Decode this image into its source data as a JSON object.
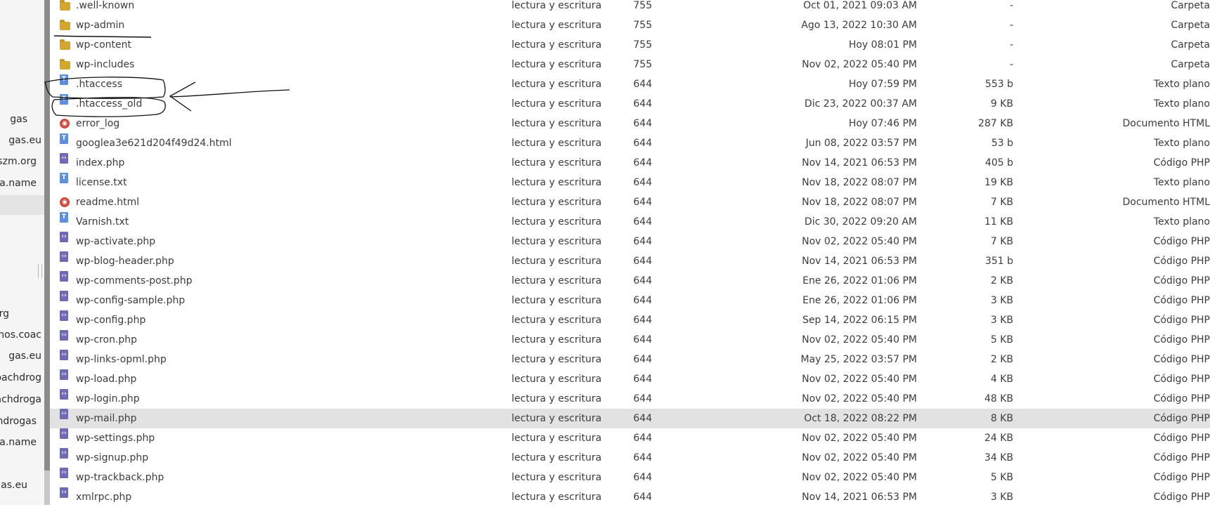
{
  "sidebar": {
    "items": [
      "gas",
      "gas.eu",
      "uszm.org",
      "a.name",
      "rg",
      "mos.coac",
      "gas.eu",
      "oachdrog",
      "achdroga",
      "achdrogas",
      "rita.name",
      "gas.eu"
    ]
  },
  "files": [
    {
      "name": ".well-known",
      "icon": "folder-icon",
      "kind": "folder",
      "perm": "lectura y escritura",
      "octal": "755",
      "date": "Oct 01, 2021 09:03 AM",
      "size": "-",
      "type": "Carpeta"
    },
    {
      "name": "wp-admin",
      "icon": "folder-icon",
      "kind": "folder",
      "perm": "lectura y escritura",
      "octal": "755",
      "date": "Ago 13, 2022 10:30 AM",
      "size": "-",
      "type": "Carpeta"
    },
    {
      "name": "wp-content",
      "icon": "folder-icon",
      "kind": "folder",
      "perm": "lectura y escritura",
      "octal": "755",
      "date": "Hoy 08:01 PM",
      "size": "-",
      "type": "Carpeta"
    },
    {
      "name": "wp-includes",
      "icon": "folder-icon",
      "kind": "folder",
      "perm": "lectura y escritura",
      "octal": "755",
      "date": "Nov 02, 2022 05:40 PM",
      "size": "-",
      "type": "Carpeta"
    },
    {
      "name": ".htaccess",
      "icon": "text-file-icon",
      "kind": "txt",
      "perm": "lectura y escritura",
      "octal": "644",
      "date": "Hoy 07:59 PM",
      "size": "553 b",
      "type": "Texto plano"
    },
    {
      "name": ".htaccess_old",
      "icon": "text-file-icon",
      "kind": "txt",
      "perm": "lectura y escritura",
      "octal": "644",
      "date": "Dic 23, 2022 00:37 AM",
      "size": "9 KB",
      "type": "Texto plano"
    },
    {
      "name": "error_log",
      "icon": "html-file-icon",
      "kind": "html",
      "perm": "lectura y escritura",
      "octal": "644",
      "date": "Hoy 07:46 PM",
      "size": "287 KB",
      "type": "Documento HTML"
    },
    {
      "name": "googlea3e621d204f49d24.html",
      "icon": "text-file-icon",
      "kind": "txt",
      "perm": "lectura y escritura",
      "octal": "644",
      "date": "Jun 08, 2022 03:57 PM",
      "size": "53 b",
      "type": "Texto plano"
    },
    {
      "name": "index.php",
      "icon": "php-file-icon",
      "kind": "php",
      "perm": "lectura y escritura",
      "octal": "644",
      "date": "Nov 14, 2021 06:53 PM",
      "size": "405 b",
      "type": "Código PHP"
    },
    {
      "name": "license.txt",
      "icon": "text-file-icon",
      "kind": "txt",
      "perm": "lectura y escritura",
      "octal": "644",
      "date": "Nov 18, 2022 08:07 PM",
      "size": "19 KB",
      "type": "Texto plano"
    },
    {
      "name": "readme.html",
      "icon": "html-file-icon",
      "kind": "html",
      "perm": "lectura y escritura",
      "octal": "644",
      "date": "Nov 18, 2022 08:07 PM",
      "size": "7 KB",
      "type": "Documento HTML"
    },
    {
      "name": "Varnish.txt",
      "icon": "text-file-icon",
      "kind": "txt",
      "perm": "lectura y escritura",
      "octal": "644",
      "date": "Dic 30, 2022 09:20 AM",
      "size": "11 KB",
      "type": "Texto plano"
    },
    {
      "name": "wp-activate.php",
      "icon": "php-file-icon",
      "kind": "php",
      "perm": "lectura y escritura",
      "octal": "644",
      "date": "Nov 02, 2022 05:40 PM",
      "size": "7 KB",
      "type": "Código PHP"
    },
    {
      "name": "wp-blog-header.php",
      "icon": "php-file-icon",
      "kind": "php",
      "perm": "lectura y escritura",
      "octal": "644",
      "date": "Nov 14, 2021 06:53 PM",
      "size": "351 b",
      "type": "Código PHP"
    },
    {
      "name": "wp-comments-post.php",
      "icon": "php-file-icon",
      "kind": "php",
      "perm": "lectura y escritura",
      "octal": "644",
      "date": "Ene 26, 2022 01:06 PM",
      "size": "2 KB",
      "type": "Código PHP"
    },
    {
      "name": "wp-config-sample.php",
      "icon": "php-file-icon",
      "kind": "php",
      "perm": "lectura y escritura",
      "octal": "644",
      "date": "Ene 26, 2022 01:06 PM",
      "size": "3 KB",
      "type": "Código PHP"
    },
    {
      "name": "wp-config.php",
      "icon": "php-file-icon",
      "kind": "php",
      "perm": "lectura y escritura",
      "octal": "644",
      "date": "Sep 14, 2022 06:15 PM",
      "size": "3 KB",
      "type": "Código PHP"
    },
    {
      "name": "wp-cron.php",
      "icon": "php-file-icon",
      "kind": "php",
      "perm": "lectura y escritura",
      "octal": "644",
      "date": "Nov 02, 2022 05:40 PM",
      "size": "5 KB",
      "type": "Código PHP"
    },
    {
      "name": "wp-links-opml.php",
      "icon": "php-file-icon",
      "kind": "php",
      "perm": "lectura y escritura",
      "octal": "644",
      "date": "May 25, 2022 03:57 PM",
      "size": "2 KB",
      "type": "Código PHP"
    },
    {
      "name": "wp-load.php",
      "icon": "php-file-icon",
      "kind": "php",
      "perm": "lectura y escritura",
      "octal": "644",
      "date": "Nov 02, 2022 05:40 PM",
      "size": "4 KB",
      "type": "Código PHP"
    },
    {
      "name": "wp-login.php",
      "icon": "php-file-icon",
      "kind": "php",
      "perm": "lectura y escritura",
      "octal": "644",
      "date": "Nov 02, 2022 05:40 PM",
      "size": "48 KB",
      "type": "Código PHP"
    },
    {
      "name": "wp-mail.php",
      "icon": "php-file-icon",
      "kind": "php",
      "perm": "lectura y escritura",
      "octal": "644",
      "date": "Oct 18, 2022 08:22 PM",
      "size": "8 KB",
      "type": "Código PHP",
      "selected": true
    },
    {
      "name": "wp-settings.php",
      "icon": "php-file-icon",
      "kind": "php",
      "perm": "lectura y escritura",
      "octal": "644",
      "date": "Nov 02, 2022 05:40 PM",
      "size": "24 KB",
      "type": "Código PHP"
    },
    {
      "name": "wp-signup.php",
      "icon": "php-file-icon",
      "kind": "php",
      "perm": "lectura y escritura",
      "octal": "644",
      "date": "Nov 02, 2022 05:40 PM",
      "size": "34 KB",
      "type": "Código PHP"
    },
    {
      "name": "wp-trackback.php",
      "icon": "php-file-icon",
      "kind": "php",
      "perm": "lectura y escritura",
      "octal": "644",
      "date": "Nov 02, 2022 05:40 PM",
      "size": "5 KB",
      "type": "Código PHP"
    },
    {
      "name": "xmlrpc.php",
      "icon": "php-file-icon",
      "kind": "php",
      "perm": "lectura y escritura",
      "octal": "644",
      "date": "Nov 14, 2021 06:53 PM",
      "size": "3 KB",
      "type": "Código PHP"
    }
  ],
  "colors": {
    "folder": "#d4a72c",
    "text_file": "#5b8fe0",
    "php_file": "#6e6ab8",
    "html_file": "#d24a3f",
    "selected_row": "#e2e2e2",
    "scrollbar": "#8c8c8c"
  }
}
